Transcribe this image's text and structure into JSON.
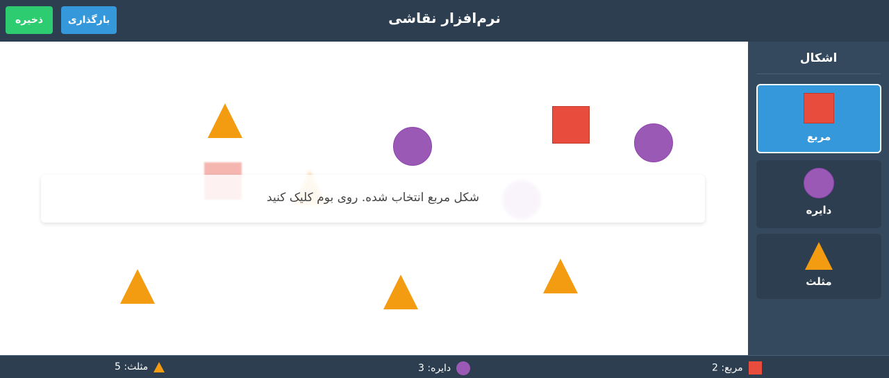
{
  "header": {
    "title": "نرم‌افزار نقاشی",
    "save_label": "ذخیره",
    "load_label": "بارگذاری",
    "save_color": "#2ecc71",
    "load_color": "#3498db"
  },
  "canvas": {
    "toast_message": "شکل مربع انتخاب شده. روی بوم کلیک کنید",
    "shapes": [
      "square",
      "square",
      "circle",
      "circle",
      "circle",
      "triangle",
      "triangle",
      "triangle",
      "triangle",
      "triangle"
    ]
  },
  "sidebar": {
    "title": "اشکال",
    "tools": [
      {
        "label": "مربع",
        "icon": "square-icon",
        "color": "#e74c3c",
        "selected": true
      },
      {
        "label": "دایره",
        "icon": "circle-icon",
        "color": "#9b59b6",
        "selected": false
      },
      {
        "label": "مثلث",
        "icon": "triangle-icon",
        "color": "#f39c12",
        "selected": false
      }
    ]
  },
  "status": {
    "square_text": "مربع: 2",
    "circle_text": "دایره: 3",
    "triangle_text": "مثلث: 5"
  }
}
